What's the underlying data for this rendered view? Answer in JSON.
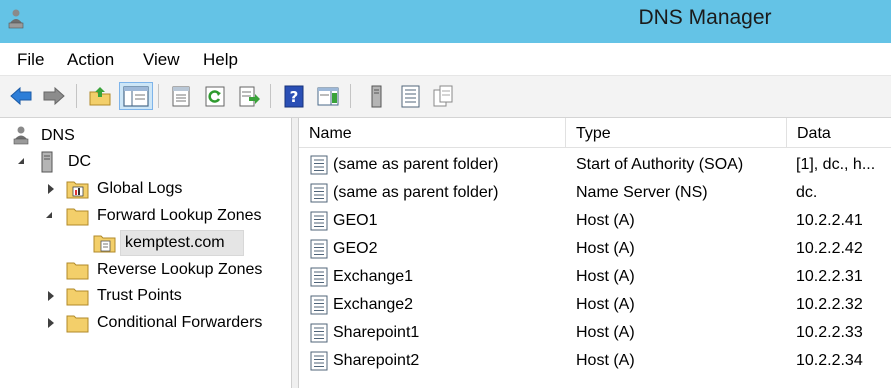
{
  "window": {
    "title": "DNS Manager",
    "app_icon": "dns-manager-icon"
  },
  "menu": [
    "File",
    "Action",
    "View",
    "Help"
  ],
  "toolbar": {
    "buttons": [
      {
        "icon": "back-arrow-icon"
      },
      {
        "icon": "forward-arrow-icon"
      },
      {
        "icon": "up-folder-icon"
      },
      {
        "icon": "show-hide-console-tree-icon"
      },
      {
        "icon": "properties-icon"
      },
      {
        "icon": "refresh-icon"
      },
      {
        "icon": "export-list-icon"
      },
      {
        "icon": "help-icon"
      },
      {
        "icon": "action-pane-icon"
      },
      {
        "icon": "server-icon"
      },
      {
        "icon": "record-list-icon"
      },
      {
        "icon": "copy-icon"
      }
    ]
  },
  "tree": {
    "root": "DNS",
    "server": "DC",
    "nodes": [
      {
        "label": "Global Logs",
        "state": "collapsed"
      },
      {
        "label": "Forward Lookup Zones",
        "state": "expanded"
      },
      {
        "label": "kemptest.com",
        "state": "selected"
      },
      {
        "label": "Reverse Lookup Zones",
        "state": "none"
      },
      {
        "label": "Trust Points",
        "state": "collapsed"
      },
      {
        "label": "Conditional Forwarders",
        "state": "collapsed"
      }
    ]
  },
  "list": {
    "columns": [
      "Name",
      "Type",
      "Data"
    ],
    "rows": [
      {
        "name": "(same as parent folder)",
        "type": "Start of Authority (SOA)",
        "data": "[1], dc., h..."
      },
      {
        "name": "(same as parent folder)",
        "type": "Name Server (NS)",
        "data": "dc."
      },
      {
        "name": "GEO1",
        "type": "Host (A)",
        "data": "10.2.2.41"
      },
      {
        "name": "GEO2",
        "type": "Host (A)",
        "data": "10.2.2.42"
      },
      {
        "name": "Exchange1",
        "type": "Host (A)",
        "data": "10.2.2.31"
      },
      {
        "name": "Exchange2",
        "type": "Host (A)",
        "data": "10.2.2.32"
      },
      {
        "name": "Sharepoint1",
        "type": "Host (A)",
        "data": "10.2.2.33"
      },
      {
        "name": "Sharepoint2",
        "type": "Host (A)",
        "data": "10.2.2.34"
      }
    ]
  },
  "colors": {
    "titlebar": "#64c3e6",
    "selection": "#e5e5e5",
    "folder": "#f3cf6a"
  }
}
